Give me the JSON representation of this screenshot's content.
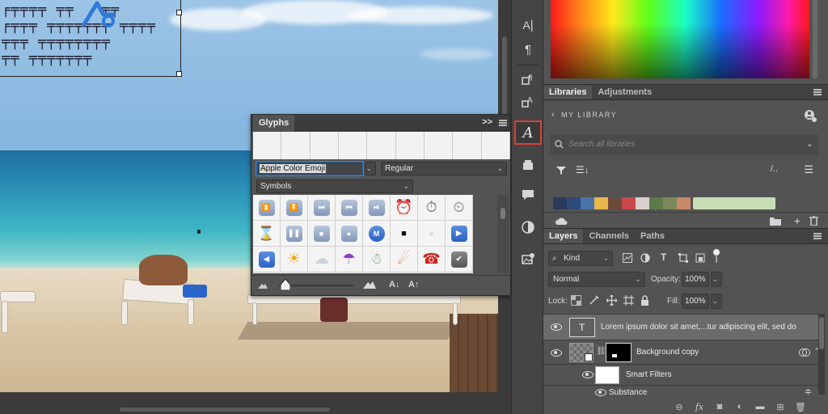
{
  "glyphs_panel": {
    "title": "Glyphs",
    "font_family": "Apple Color Emoji",
    "font_style": "Regular",
    "category": "Symbols",
    "collapse_label": ">>"
  },
  "libraries_panel": {
    "tabs": [
      "Libraries",
      "Adjustments"
    ],
    "library_name": "MY LIBRARY",
    "search_placeholder": "Search all libraries",
    "colors": [
      "#2b3a5c",
      "#2e4a7a",
      "#4a73a8",
      "#e8b54a",
      "#6c4a3a",
      "#c84a4a",
      "#d9d0d0",
      "#5c7a4a",
      "#7a8a5a",
      "#c8886a",
      "#c9ddb5"
    ]
  },
  "layers_panel": {
    "tabs": [
      "Layers",
      "Channels",
      "Paths"
    ],
    "filter_kind": "Kind",
    "blend_mode": "Normal",
    "opacity_label": "Opacity:",
    "opacity_value": "100%",
    "lock_label": "Lock:",
    "fill_label": "Fill:",
    "fill_value": "100%",
    "layers": [
      {
        "name": "Lorem ipsum dolor sit amet,...tur adipiscing elit, sed do",
        "type": "text"
      },
      {
        "name": "Background copy",
        "type": "smart"
      },
      {
        "name": "Smart Filters",
        "type": "filters"
      },
      {
        "name": "Substance",
        "type": "filter"
      }
    ],
    "text_thumb_glyph": "T"
  },
  "toolbar": {
    "character_glyph": "A"
  },
  "accent_colors": {
    "selection_outline": "#d94135",
    "focus_blue": "#3e86d6"
  }
}
